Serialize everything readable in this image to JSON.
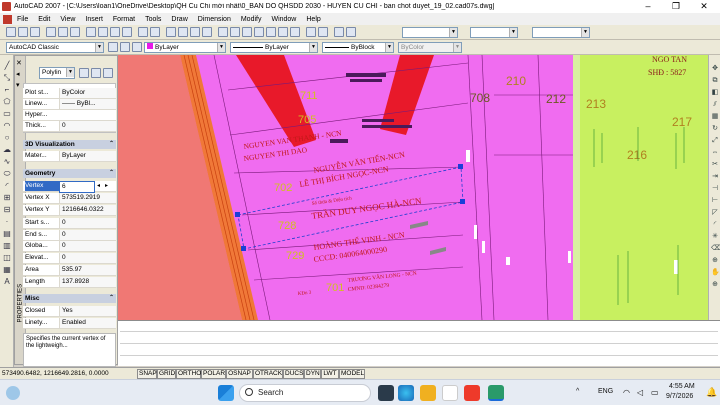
{
  "window": {
    "title": "AutoCAD 2007 - [C:\\Users\\loan1\\OneDrive\\Desktop\\QH Cu Chi mới nhất\\0_BAN DO QHSDD 2030 - HUYEN CU CHI - ban chot duyet_19_02.cad07s.dwg]",
    "minimize": "–",
    "restore": "❐",
    "close": "✕"
  },
  "menu": [
    "File",
    "Edit",
    "View",
    "Insert",
    "Format",
    "Tools",
    "Draw",
    "Dimension",
    "Modify",
    "Window",
    "Help"
  ],
  "toolbar2": {
    "workspace": "AutoCAD Classic",
    "layer_color": "ByLayer",
    "linetype": "ByLayer",
    "lineweight": "ByBlock",
    "plotstyle": "ByColor"
  },
  "properties": {
    "object_type": "Polylin",
    "palette_title": "PROPERTIES",
    "general_rows": [
      {
        "k": "Plot st...",
        "v": "ByColor"
      },
      {
        "k": "Linew...",
        "v": "—— ByBl..."
      },
      {
        "k": "Hyper...",
        "v": ""
      },
      {
        "k": "Thick...",
        "v": "0"
      }
    ],
    "sec_3d": "3D Visualization",
    "material": {
      "k": "Mater...",
      "v": "ByLayer"
    },
    "sec_geometry": "Geometry",
    "geometry_rows": [
      {
        "k": "Vertex",
        "v": "6"
      },
      {
        "k": "Vertex X",
        "v": "573519.2919"
      },
      {
        "k": "Vertex Y",
        "v": "1216646.0322"
      },
      {
        "k": "Start s...",
        "v": "0"
      },
      {
        "k": "End s...",
        "v": "0"
      },
      {
        "k": "Globa...",
        "v": "0"
      },
      {
        "k": "Elevat...",
        "v": "0"
      },
      {
        "k": "Area",
        "v": "535.97"
      },
      {
        "k": "Length",
        "v": "137.8928"
      }
    ],
    "sec_misc": "Misc",
    "misc_rows": [
      {
        "k": "Closed",
        "v": "Yes"
      },
      {
        "k": "Linety...",
        "v": "Enabled"
      }
    ],
    "description": "Specifies the current vertex of the lightweigh..."
  },
  "drawing": {
    "top_right_label": "NGO TAN",
    "top_right_sub": "SHĐ : 5827",
    "lot_numbers": [
      "711",
      "705",
      "702",
      "728",
      "729",
      "701",
      "708",
      "212",
      "213",
      "217",
      "216",
      "210"
    ],
    "owners": [
      "NGUYEN VAN THANH - NCN",
      "NGUYEN THI DAO",
      "NGUYỄN VĂN TIẾN-NCN",
      "LÊ THỊ BÍCH NGỌC-NCN",
      "TRẦN DUY NGỌC HÀ-NCN",
      "HOÀNG THẾ VINH - NCN",
      "CCCD: 040064000290",
      "TRƯƠNG VĂN LONG - NCN",
      "CMND: 02384279",
      "KĐn 3"
    ],
    "small_label": "Số thửa & Diện tích"
  },
  "status": {
    "coords": "573490.6482, 1216649.2816, 0.0000",
    "toggles": [
      "SNAP",
      "GRID",
      "ORTHO",
      "POLAR",
      "OSNAP",
      "OTRACK",
      "DUCS",
      "DYN",
      "LWT",
      "MODEL"
    ]
  },
  "taskbar": {
    "search_placeholder": "Search",
    "lang": "ENG",
    "time": "4:55 AM",
    "date": "9/7/2026",
    "chevron": "^"
  },
  "colors": {
    "parcel_magenta": "#f06cf0",
    "road_orange": "#f07838",
    "red_band": "#e8192a",
    "green_zone": "#c8f060",
    "accent_blue": "#316ac5"
  }
}
